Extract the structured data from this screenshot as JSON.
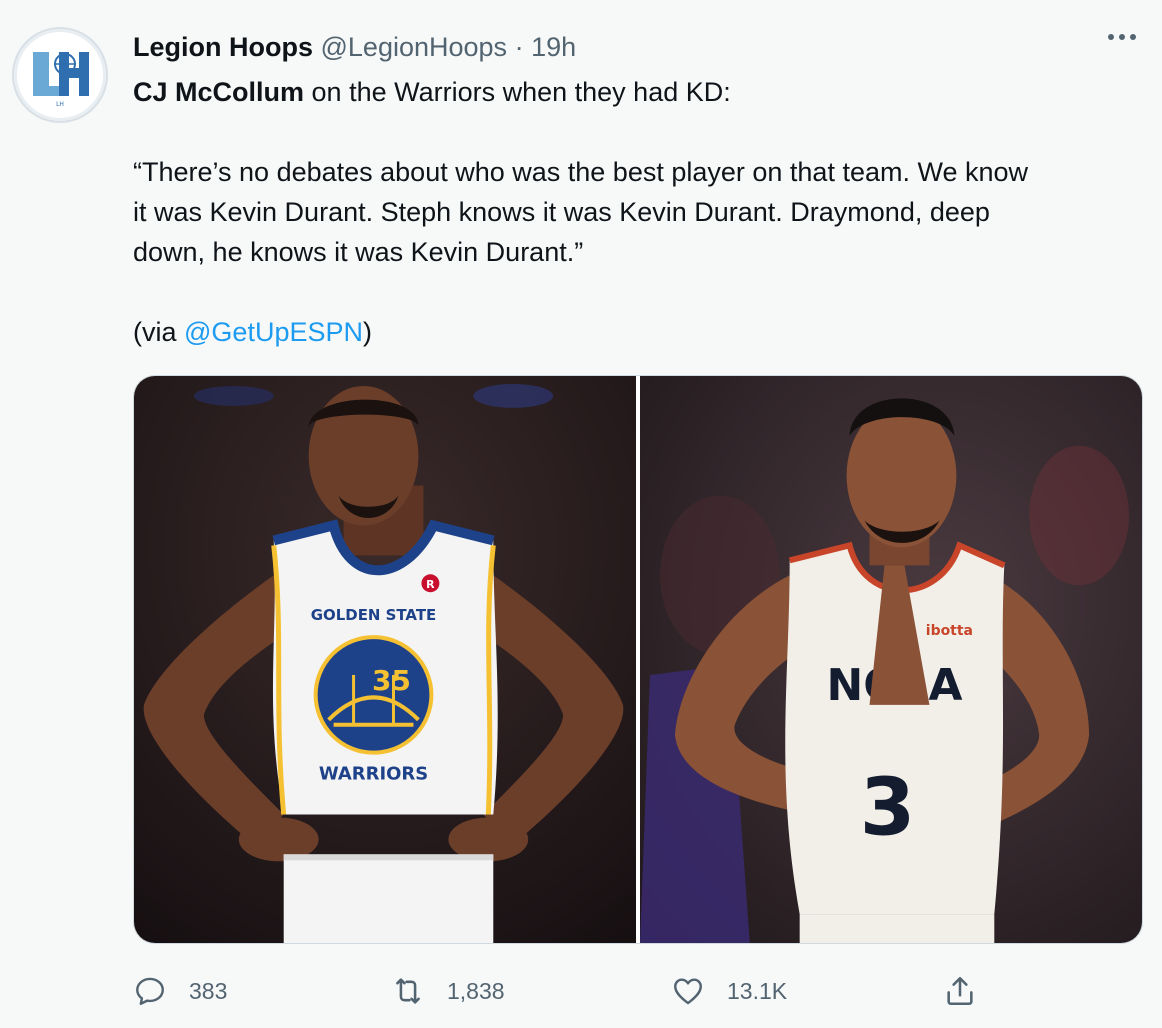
{
  "tweet": {
    "author_name": "Legion Hoops",
    "author_handle": "@LegionHoops",
    "separator": "·",
    "time": "19h",
    "line1_bold": "CJ McCollum",
    "line1_rest": " on the Warriors when they had KD:",
    "quote_line1": "“There’s no debates about who was the best player on that team. We know",
    "quote_line2": "it was Kevin Durant. Steph knows it was Kevin Durant. Draymond, deep",
    "quote_line3": "down, he knows it was Kevin Durant.”",
    "via_prefix": "(via ",
    "via_link": "@GetUpESPN",
    "via_suffix": ")"
  },
  "avatar": {
    "icon": "legion-hoops-logo",
    "logo_text": "LH"
  },
  "media": {
    "left": {
      "jersey_brand": "GOLDEN STATE",
      "jersey_team": "WARRIORS",
      "jersey_number": "35",
      "sponsor": "R"
    },
    "right": {
      "jersey_sponsor": "ibotta",
      "jersey_letters": "NOLA",
      "jersey_number": "3"
    }
  },
  "actions": {
    "reply_count": "383",
    "retweet_count": "1,838",
    "like_count": "13.1K"
  },
  "colors": {
    "background": "#f7f9f9",
    "text": "#0f1419",
    "secondary": "#536471",
    "link": "#1d9bf0"
  }
}
